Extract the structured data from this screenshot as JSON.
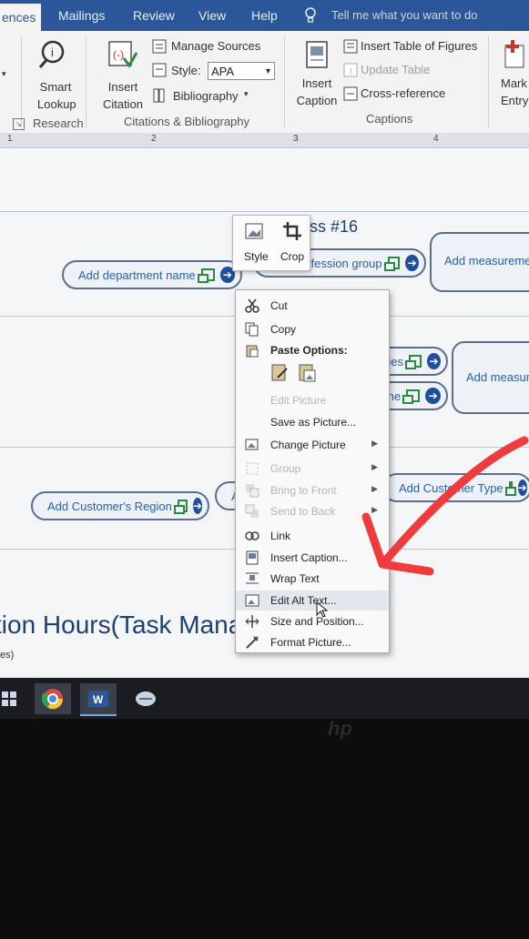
{
  "ribbon": {
    "tabs": [
      "ences",
      "Mailings",
      "Review",
      "View",
      "Help"
    ],
    "tell_me": "Tell me what you want to do",
    "smart_lookup": "Smart Lookup",
    "research_group": "Research",
    "insert_citation": "Insert Citation",
    "manage_sources": "Manage Sources",
    "style_label": "Style:",
    "style_value": "APA",
    "bibliography": "Bibliography",
    "citations_group": "Citations & Bibliography",
    "insert_caption": "Insert Caption",
    "insert_table_figures": "Insert Table of Figures",
    "update_table": "Update Table",
    "cross_reference": "Cross-reference",
    "captions_group": "Captions",
    "mark_entry": "Mark Entry"
  },
  "ruler": {
    "marks": [
      "1",
      "2",
      "3",
      "4"
    ]
  },
  "document": {
    "title_fragment": "ss #16",
    "pills": [
      "Add department name",
      "Add profession group",
      "Add measuremen",
      "ries",
      "me",
      "Add measure",
      "Add Customer's Region",
      "Ad",
      "Add Customer Type"
    ],
    "big_text": "tion Hours(Task Mana",
    "status": "es)"
  },
  "mini_toolbar": {
    "style": "Style",
    "crop": "Crop"
  },
  "context_menu": {
    "items": [
      {
        "label": "Cut",
        "enabled": true,
        "icon": "scissors-icon"
      },
      {
        "label": "Copy",
        "enabled": true,
        "icon": "copy-icon"
      },
      {
        "label": "Paste Options:",
        "enabled": true,
        "icon": "paste-icon",
        "header": true
      },
      {
        "label": "Edit Picture",
        "enabled": false
      },
      {
        "label": "Save as Picture...",
        "enabled": true
      },
      {
        "label": "Change Picture",
        "enabled": true,
        "icon": "change-picture-icon",
        "submenu": true
      },
      {
        "label": "Group",
        "enabled": false,
        "icon": "group-icon",
        "submenu": true
      },
      {
        "label": "Bring to Front",
        "enabled": false,
        "icon": "bring-front-icon",
        "submenu": true
      },
      {
        "label": "Send to Back",
        "enabled": false,
        "icon": "send-back-icon",
        "submenu": true
      },
      {
        "label": "Link",
        "enabled": true,
        "icon": "link-icon"
      },
      {
        "label": "Insert Caption...",
        "enabled": true,
        "icon": "caption-icon"
      },
      {
        "label": "Wrap Text",
        "enabled": true,
        "icon": "wrap-text-icon",
        "submenu": true
      },
      {
        "label": "Edit Alt Text...",
        "enabled": true,
        "icon": "alt-text-icon"
      },
      {
        "label": "Size and Position...",
        "enabled": true,
        "icon": "size-position-icon"
      },
      {
        "label": "Format Picture...",
        "enabled": true,
        "icon": "format-picture-icon"
      }
    ]
  },
  "colors": {
    "ribbon_tab": "#2b579a",
    "annotation_arrow": "#ef3b3b"
  }
}
